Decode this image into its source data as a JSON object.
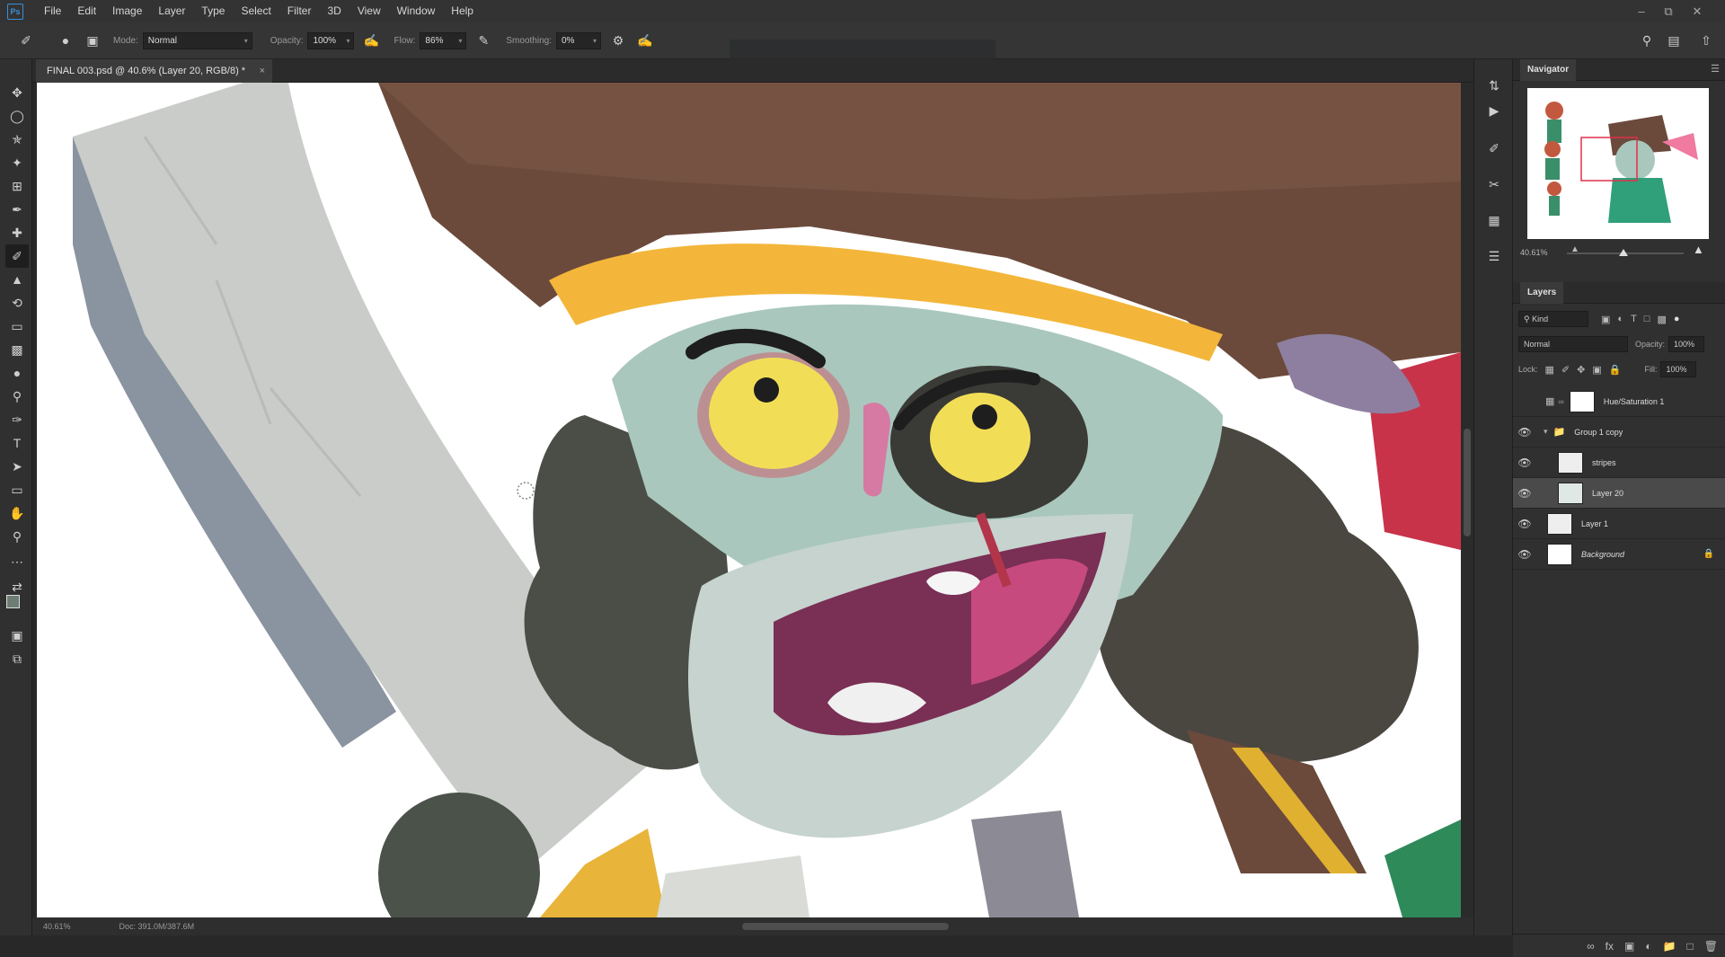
{
  "app": {
    "name": "Ps"
  },
  "menu": [
    "File",
    "Edit",
    "Image",
    "Layer",
    "Type",
    "Select",
    "Filter",
    "3D",
    "View",
    "Window",
    "Help"
  ],
  "options": {
    "mode_label": "Mode:",
    "mode_value": "Normal",
    "opacity_label": "Opacity:",
    "opacity_value": "100%",
    "flow_label": "Flow:",
    "flow_value": "86%",
    "smoothing_label": "Smoothing:",
    "smoothing_value": "0%"
  },
  "document": {
    "tab_title": "FINAL 003.psd @ 40.6% (Layer 20, RGB/8) *"
  },
  "status": {
    "zoom": "40.61%",
    "doc": "Doc: 391.0M/387.6M"
  },
  "navigator": {
    "title": "Navigator",
    "zoom": "40.61%"
  },
  "layers": {
    "title": "Layers",
    "kind": "Kind",
    "blend": "Normal",
    "opacity_label": "Opacity:",
    "opacity_value": "100%",
    "lock_label": "Lock:",
    "fill_label": "Fill:",
    "fill_value": "100%",
    "items": [
      {
        "name": "Hue/Saturation 1"
      },
      {
        "name": "Group 1 copy"
      },
      {
        "name": "stripes"
      },
      {
        "name": "Layer 20"
      },
      {
        "name": "Layer 1"
      },
      {
        "name": "Background"
      }
    ]
  },
  "colors": {
    "accent": "#3a8fd8",
    "hat": "#6b4a3c",
    "gold": "#f3b63a",
    "skin": "#a9c7bd",
    "mouth": "#7a2f55"
  }
}
